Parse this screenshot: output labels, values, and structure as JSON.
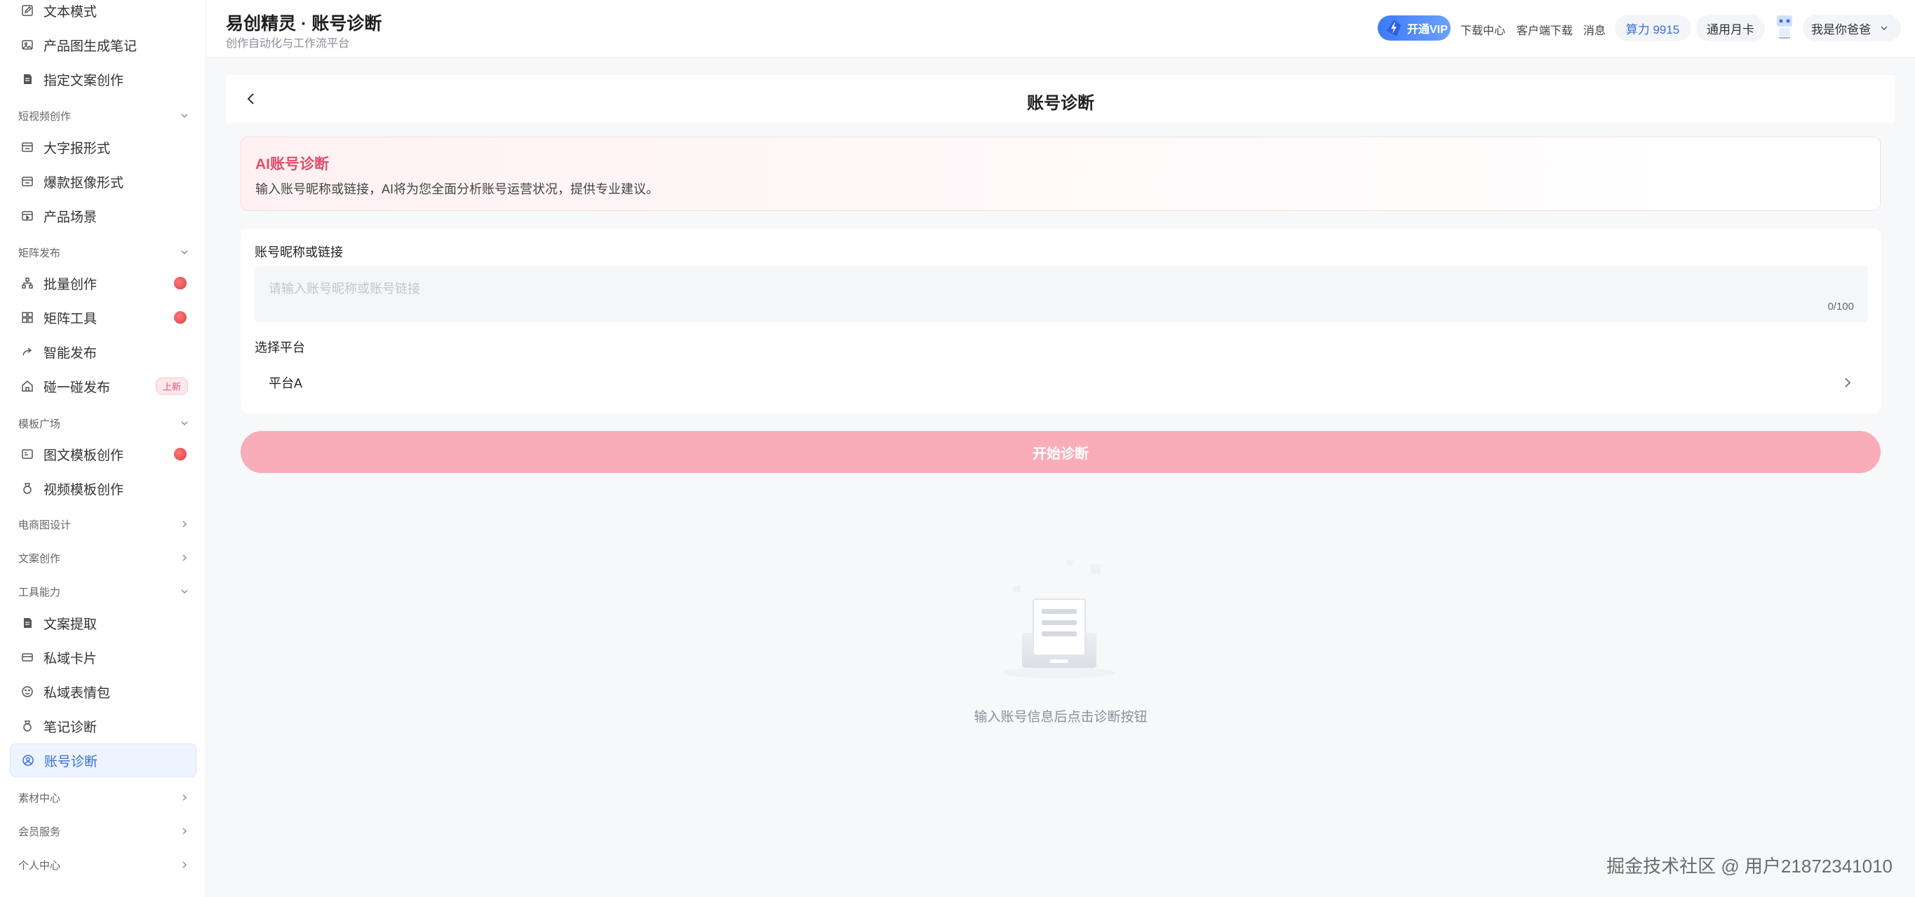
{
  "sidebar": {
    "items": [
      {
        "label": "文本模式",
        "icon": "edit-square-icon"
      },
      {
        "label": "产品图生成笔记",
        "icon": "image-icon"
      },
      {
        "label": "指定文案创作",
        "icon": "document-icon"
      },
      {
        "label": "大字报形式",
        "icon": "card-icon"
      },
      {
        "label": "爆款抠像形式",
        "icon": "card-icon"
      },
      {
        "label": "产品场景",
        "icon": "play-card-icon"
      },
      {
        "label": "批量创作",
        "icon": "org-chart-icon",
        "badge": true
      },
      {
        "label": "矩阵工具",
        "icon": "grid-icon",
        "badge": true
      },
      {
        "label": "智能发布",
        "icon": "share-icon"
      },
      {
        "label": "碰一碰发布",
        "icon": "home-icon",
        "tag": "上新"
      },
      {
        "label": "图文模板创作",
        "icon": "image-text-icon",
        "badge": true
      },
      {
        "label": "视频模板创作",
        "icon": "medal-icon"
      },
      {
        "label": "文案提取",
        "icon": "document-icon"
      },
      {
        "label": "私域卡片",
        "icon": "card-icon"
      },
      {
        "label": "私域表情包",
        "icon": "smile-icon"
      },
      {
        "label": "笔记诊断",
        "icon": "medal-icon"
      },
      {
        "label": "账号诊断",
        "icon": "user-circle-icon",
        "active": true
      }
    ],
    "groups": [
      {
        "label": "短视频创作",
        "expanded": true
      },
      {
        "label": "矩阵发布",
        "expanded": true
      },
      {
        "label": "模板广场",
        "expanded": true
      },
      {
        "label": "电商图设计",
        "expanded": false
      },
      {
        "label": "文案创作",
        "expanded": false
      },
      {
        "label": "工具能力",
        "expanded": true
      },
      {
        "label": "素材中心",
        "expanded": false
      },
      {
        "label": "会员服务",
        "expanded": false
      },
      {
        "label": "个人中心",
        "expanded": false
      }
    ]
  },
  "header": {
    "title": "易创精灵 · 账号诊断",
    "subtitle": "创作自动化与工作流平台",
    "vip_label": "开通VIP",
    "download_center": "下载中心",
    "client_download": "客户端下载",
    "messages": "消息",
    "power_label": "算力 9915",
    "monthly_card": "通用月卡",
    "user_name": "我是你爸爸"
  },
  "page": {
    "title": "账号诊断",
    "info_title": "AI账号诊断",
    "info_desc": "输入账号昵称或链接，AI将为您全面分析账号运营状况，提供专业建议。",
    "account_label": "账号昵称或链接",
    "account_placeholder": "请输入账号昵称或账号链接",
    "account_value": "",
    "counter": "0/100",
    "platform_label": "选择平台",
    "platform_value": "平台A",
    "start_button": "开始诊断",
    "empty_text": "输入账号信息后点击诊断按钮"
  },
  "watermark": "掘金技术社区 @ 用户21872341010",
  "colors": {
    "accent_blue": "#3a6fd8",
    "accent_pink": "#e04e6a",
    "button_pink": "#f9adb8"
  }
}
